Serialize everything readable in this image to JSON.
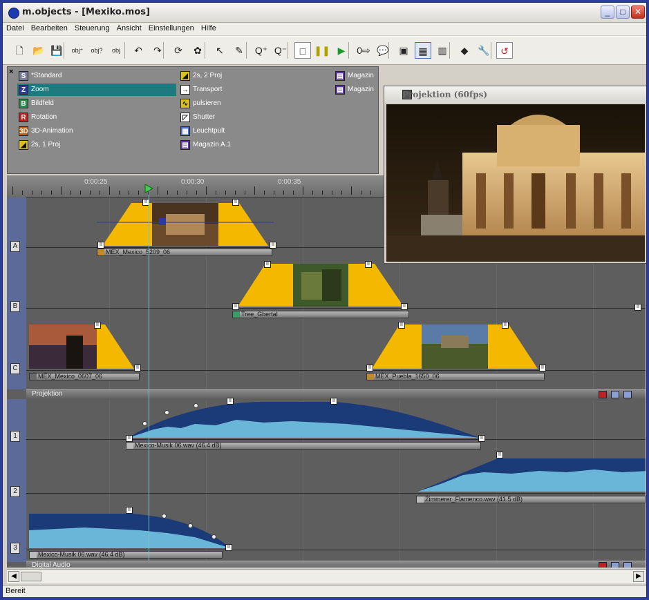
{
  "window": {
    "title": "m.objects - [Mexiko.mos]"
  },
  "window_controls": {
    "minimize": "_",
    "maximize": "□",
    "close": "✕"
  },
  "menu": [
    "Datei",
    "Bearbeiten",
    "Steuerung",
    "Ansicht",
    "Einstellungen",
    "Hilfe"
  ],
  "toolbar": [
    {
      "name": "new-icon",
      "glyph": "🗋"
    },
    {
      "name": "open-icon",
      "glyph": "📂"
    },
    {
      "name": "save-icon",
      "glyph": "💾"
    },
    {
      "name": "obj-add-icon",
      "glyph": "obj⁺"
    },
    {
      "name": "obj-info-icon",
      "glyph": "obj?"
    },
    {
      "name": "obj-icon",
      "glyph": "obj"
    },
    {
      "name": "undo-icon",
      "glyph": "↶"
    },
    {
      "name": "redo-icon",
      "glyph": "↷"
    },
    {
      "name": "rotate-icon",
      "glyph": "⟳"
    },
    {
      "name": "effect-icon",
      "glyph": "✿"
    },
    {
      "name": "pointer-icon",
      "glyph": "↖"
    },
    {
      "name": "pen-icon",
      "glyph": "✎"
    },
    {
      "name": "zoom-in-icon",
      "glyph": "Q⁺"
    },
    {
      "name": "zoom-out-icon",
      "glyph": "Q⁻"
    },
    {
      "name": "stop-icon",
      "glyph": "□"
    },
    {
      "name": "pause-icon",
      "glyph": "❚❚"
    },
    {
      "name": "play-icon",
      "glyph": "▶"
    },
    {
      "name": "position-icon",
      "glyph": "0⇨"
    },
    {
      "name": "tooltip-icon",
      "glyph": "💬"
    },
    {
      "name": "projection-icon",
      "glyph": "▣"
    },
    {
      "name": "lightbox-icon",
      "glyph": "▦"
    },
    {
      "name": "magazine-icon",
      "glyph": "▥"
    },
    {
      "name": "objects-icon",
      "glyph": "◆"
    },
    {
      "name": "wrench-icon",
      "glyph": "🔧"
    },
    {
      "name": "loop-icon",
      "glyph": "↺"
    }
  ],
  "object_palette": {
    "col1": [
      {
        "label": "*Standard",
        "icon": "std",
        "color": "#7a7a9a",
        "letter": "S"
      },
      {
        "label": "Zoom",
        "icon": "zoom",
        "color": "#2a3aa0",
        "letter": "Z"
      },
      {
        "label": "Bildfeld",
        "icon": "bildfeld",
        "color": "#2a8a4a",
        "letter": "B"
      },
      {
        "label": "Rotation",
        "icon": "rotation",
        "color": "#c02020",
        "letter": "R"
      },
      {
        "label": "3D-Animation",
        "icon": "3d",
        "color": "#c06010",
        "letter": "3D"
      },
      {
        "label": "2s, 1 Proj",
        "icon": "fade",
        "color": "#d8c020",
        "letter": "◢"
      }
    ],
    "col2": [
      {
        "label": "2s, 2 Proj",
        "icon": "fade2",
        "color": "#d8c020",
        "letter": "◢"
      },
      {
        "label": "Transport",
        "icon": "transport",
        "color": "#ffffff",
        "letter": "→"
      },
      {
        "label": "pulsieren",
        "icon": "pulse",
        "color": "#d8c020",
        "letter": "∿"
      },
      {
        "label": "Shutter",
        "icon": "shutter",
        "color": "#ffffff",
        "letter": "◸"
      },
      {
        "label": "Leuchtpult",
        "icon": "lightbox",
        "color": "#4a6ad0",
        "letter": "▦"
      },
      {
        "label": "Magazin A.1",
        "icon": "magazine",
        "color": "#5a3aa0",
        "letter": "▤"
      }
    ],
    "col3": [
      {
        "label": "Magazin",
        "icon": "magazine",
        "color": "#5a3aa0",
        "letter": "▤"
      },
      {
        "label": "Magazin",
        "icon": "magazine",
        "color": "#5a3aa0",
        "letter": "▤"
      }
    ]
  },
  "ruler": {
    "labels": [
      "0:00:25",
      "0:00:30",
      "0:00:35"
    ]
  },
  "video_tracks": [
    {
      "id": "A",
      "clips": [
        {
          "label": "MEX_Mexico_5209_06"
        }
      ]
    },
    {
      "id": "B",
      "clips": [
        {
          "label": "Tree_Gbertal"
        }
      ]
    },
    {
      "id": "C",
      "clips": [
        {
          "label": "MEX_Mexico_0607_06"
        },
        {
          "label": "MEX_Puebla_1650_06"
        }
      ]
    }
  ],
  "sections": {
    "projection": "Projektion",
    "audio": "Digital Audio"
  },
  "audio_tracks": [
    {
      "id": "1",
      "clips": [
        {
          "label": "Mexico-Musik 06.wav (46.4 dB)"
        }
      ]
    },
    {
      "id": "2",
      "clips": [
        {
          "label": "Zimmerer_Flamenco.wav (41.5 dB)"
        }
      ]
    },
    {
      "id": "3",
      "clips": [
        {
          "label": "Mexico-Musik 06.wav (46.4 dB)"
        }
      ]
    }
  ],
  "projection_window": {
    "title": "Projektion (60fps)"
  },
  "status": {
    "text": "Bereit"
  },
  "colors": {
    "accent_yellow": "#f4b800",
    "track_bg": "#5e5e5e",
    "audio_wave_dark": "#1a3a78",
    "audio_wave_light": "#6ab6d8",
    "selection": "#1e7a7e"
  }
}
